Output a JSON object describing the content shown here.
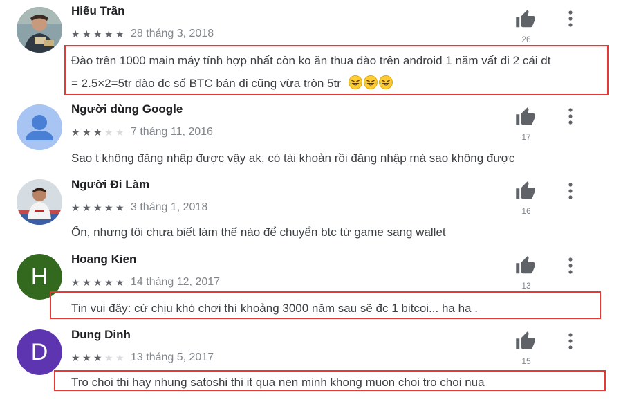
{
  "reviews": [
    {
      "author": "Hiếu Trần",
      "avatar": "photo-avatar",
      "stars": 5,
      "date": "28 tháng 3, 2018",
      "helpful_count": "26",
      "text_line1": "Đào trên 1000 main máy tính hợp nhất còn ko ăn thua đào trên android 1 năm vất đi 2 cái dt",
      "text_line2": "= 2.5×2=5tr đào đc số BTC bán đi cũng vừa tròn 5tr",
      "emoji": [
        "laughing-emoji",
        "laughing-emoji",
        "laughing-emoji"
      ]
    },
    {
      "author": "Người dùng Google",
      "avatar": "default-user-avatar",
      "stars": 3,
      "date": "7 tháng 11, 2016",
      "helpful_count": "17",
      "text": "Sao t không đăng nhập được vậy ak, có tài khoản rồi đăng nhập mà sao không được"
    },
    {
      "author": "Người Đi Làm",
      "avatar": "photo-avatar",
      "stars": 5,
      "date": "3 tháng 1, 2018",
      "helpful_count": "16",
      "text": "Ổn, nhưng tôi chưa biết làm thế nào để chuyển btc từ game sang wallet"
    },
    {
      "author": "Hoang Kien",
      "avatar_letter": "H",
      "avatar_color": "#33691e",
      "stars": 5,
      "date": "14 tháng 12, 2017",
      "helpful_count": "13",
      "text": "Tin vui đây: cứ chịu khó chơi thì khoảng 3000 năm sau sẽ đc 1 bitcoi... ha ha ."
    },
    {
      "author": "Dung Dinh",
      "avatar_letter": "D",
      "avatar_color": "#5e35b1",
      "stars": 3,
      "date": "13 tháng 5, 2017",
      "helpful_count": "15",
      "text": "Tro choi thi hay nhung satoshi thi it qua nen minh khong muon choi tro choi nua"
    }
  ],
  "colors": {
    "highlight": "#e53935",
    "star_on": "#5f6368",
    "star_off": "#dadce0",
    "icon": "#5f6368"
  },
  "icons": {
    "thumb": "thumbs-up-icon",
    "more": "more-vert-icon",
    "star": "star-icon"
  }
}
